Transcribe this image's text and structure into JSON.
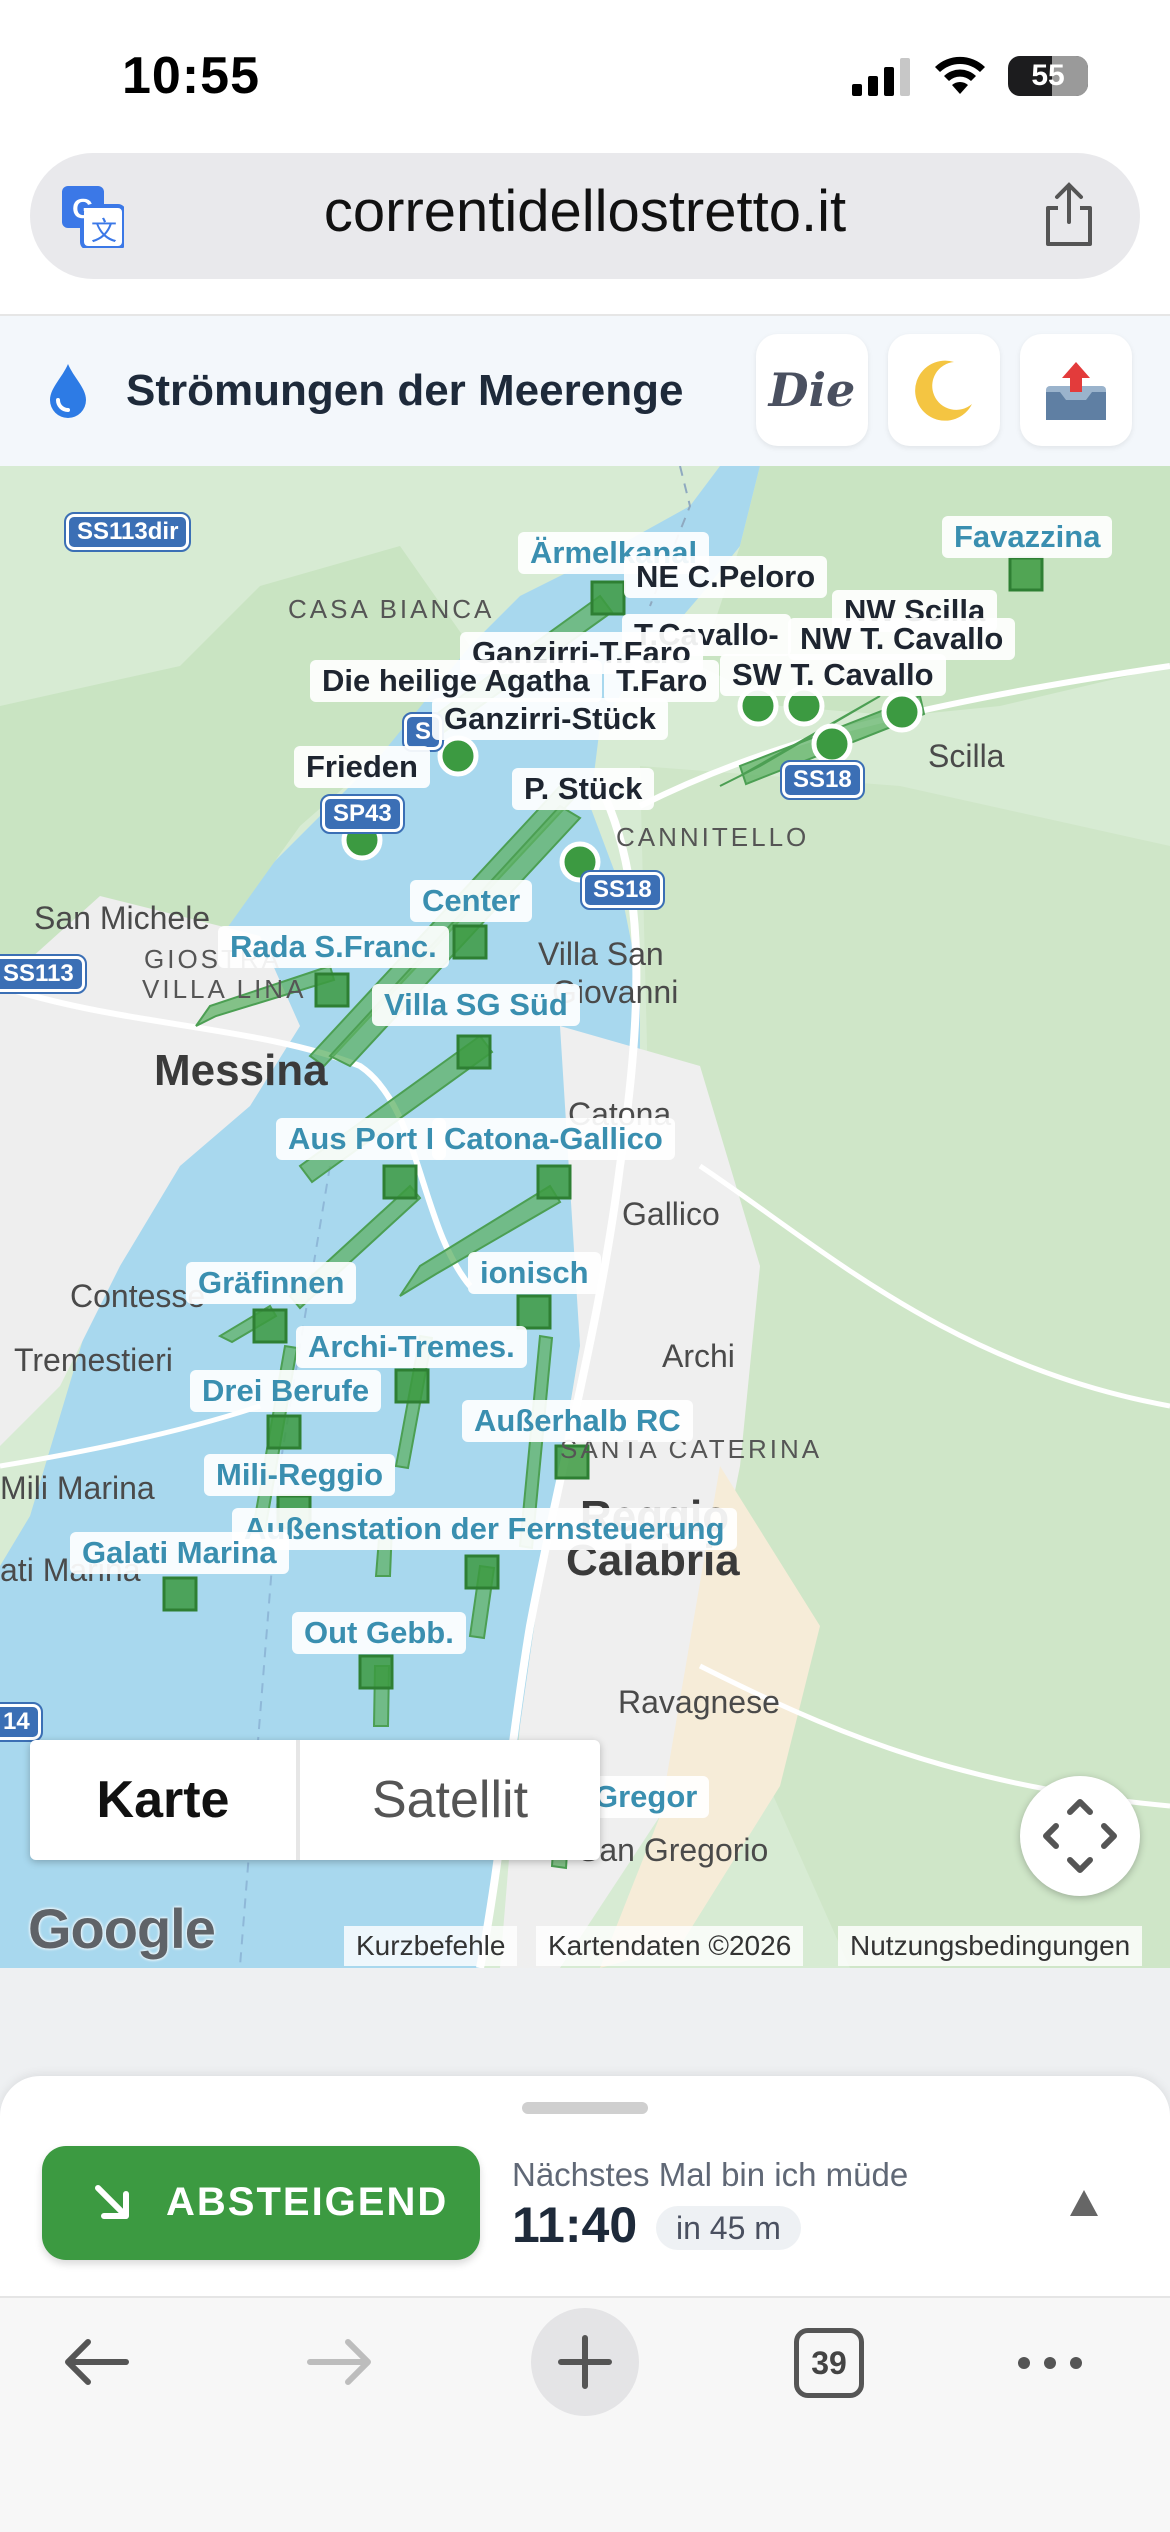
{
  "status_bar": {
    "time": "10:55",
    "battery": "55"
  },
  "browser": {
    "url": "correntidellostretto.it"
  },
  "header": {
    "title": "Strömungen der Meerenge",
    "font_button_label": "Die",
    "moon_glyph": "🌙"
  },
  "map": {
    "station_labels": [
      "Ärmelkanal",
      "Favazzina",
      "NE C.Peloro",
      "NW Scilla",
      "T.Cavallo-",
      "NW T. Cavallo",
      "Ganzirri-T.Faro",
      "Die heilige Agatha",
      "T.Faro",
      "SW T. Cavallo",
      "Ganzirri-Stück",
      "Frieden",
      "P. Stück",
      "Center",
      "Rada S.Franc.",
      "Villa SG Süd",
      "Aus Port I",
      "Catona-Gallico",
      "ionisch",
      "Gräfinnen",
      "Archi-Tremes.",
      "Drei Berufe",
      "Außerhalb RC",
      "Mili-Reggio",
      "Außenstation der Fernsteuerung",
      "Galati Marina",
      "Out Gebb.",
      "Gregor"
    ],
    "places": {
      "casa_bianca": "CASA BIANCA",
      "scilla": "Scilla",
      "cannitello": "CANNITELLO",
      "san_michele": "San Michele",
      "giostra": "GIOSTRA",
      "villa_lina": "VILLA LINA",
      "villa_san_giovanni_1": "Villa San",
      "villa_san_giovanni_2": "Giovanni",
      "messina": "Messina",
      "catona": "Catona",
      "gallico": "Gallico",
      "contesse": "Contesse",
      "tremestieri": "Tremestieri",
      "archi": "Archi",
      "santa_caterina": "SANTA CATERINA",
      "mili_marina": "Mili Marina",
      "ati_marina": "ati Marina",
      "reggio": "Reggio",
      "calabria": "Calabria",
      "ravagnese": "Ravagnese",
      "san_gregorio": "San Gregorio"
    },
    "road_shields": [
      "SS113dir",
      "SP43",
      "SS18",
      "SS18",
      "SS113",
      "S",
      "14"
    ],
    "map_type_options": [
      "Karte",
      "Satellit"
    ],
    "selected_map_type": "Karte",
    "google_logo": "Google",
    "attributions": [
      "Kurzbefehle",
      "Kartendaten ©2026",
      "Nutzungsbedingungen"
    ]
  },
  "tide_panel": {
    "direction_label": "ABSTEIGEND",
    "next_label": "Nächstes Mal bin ich müde",
    "next_time": "11:40",
    "next_in": "in 45 m",
    "accent_color": "#3c9a41"
  },
  "toolbar": {
    "tabs_count": "39"
  }
}
